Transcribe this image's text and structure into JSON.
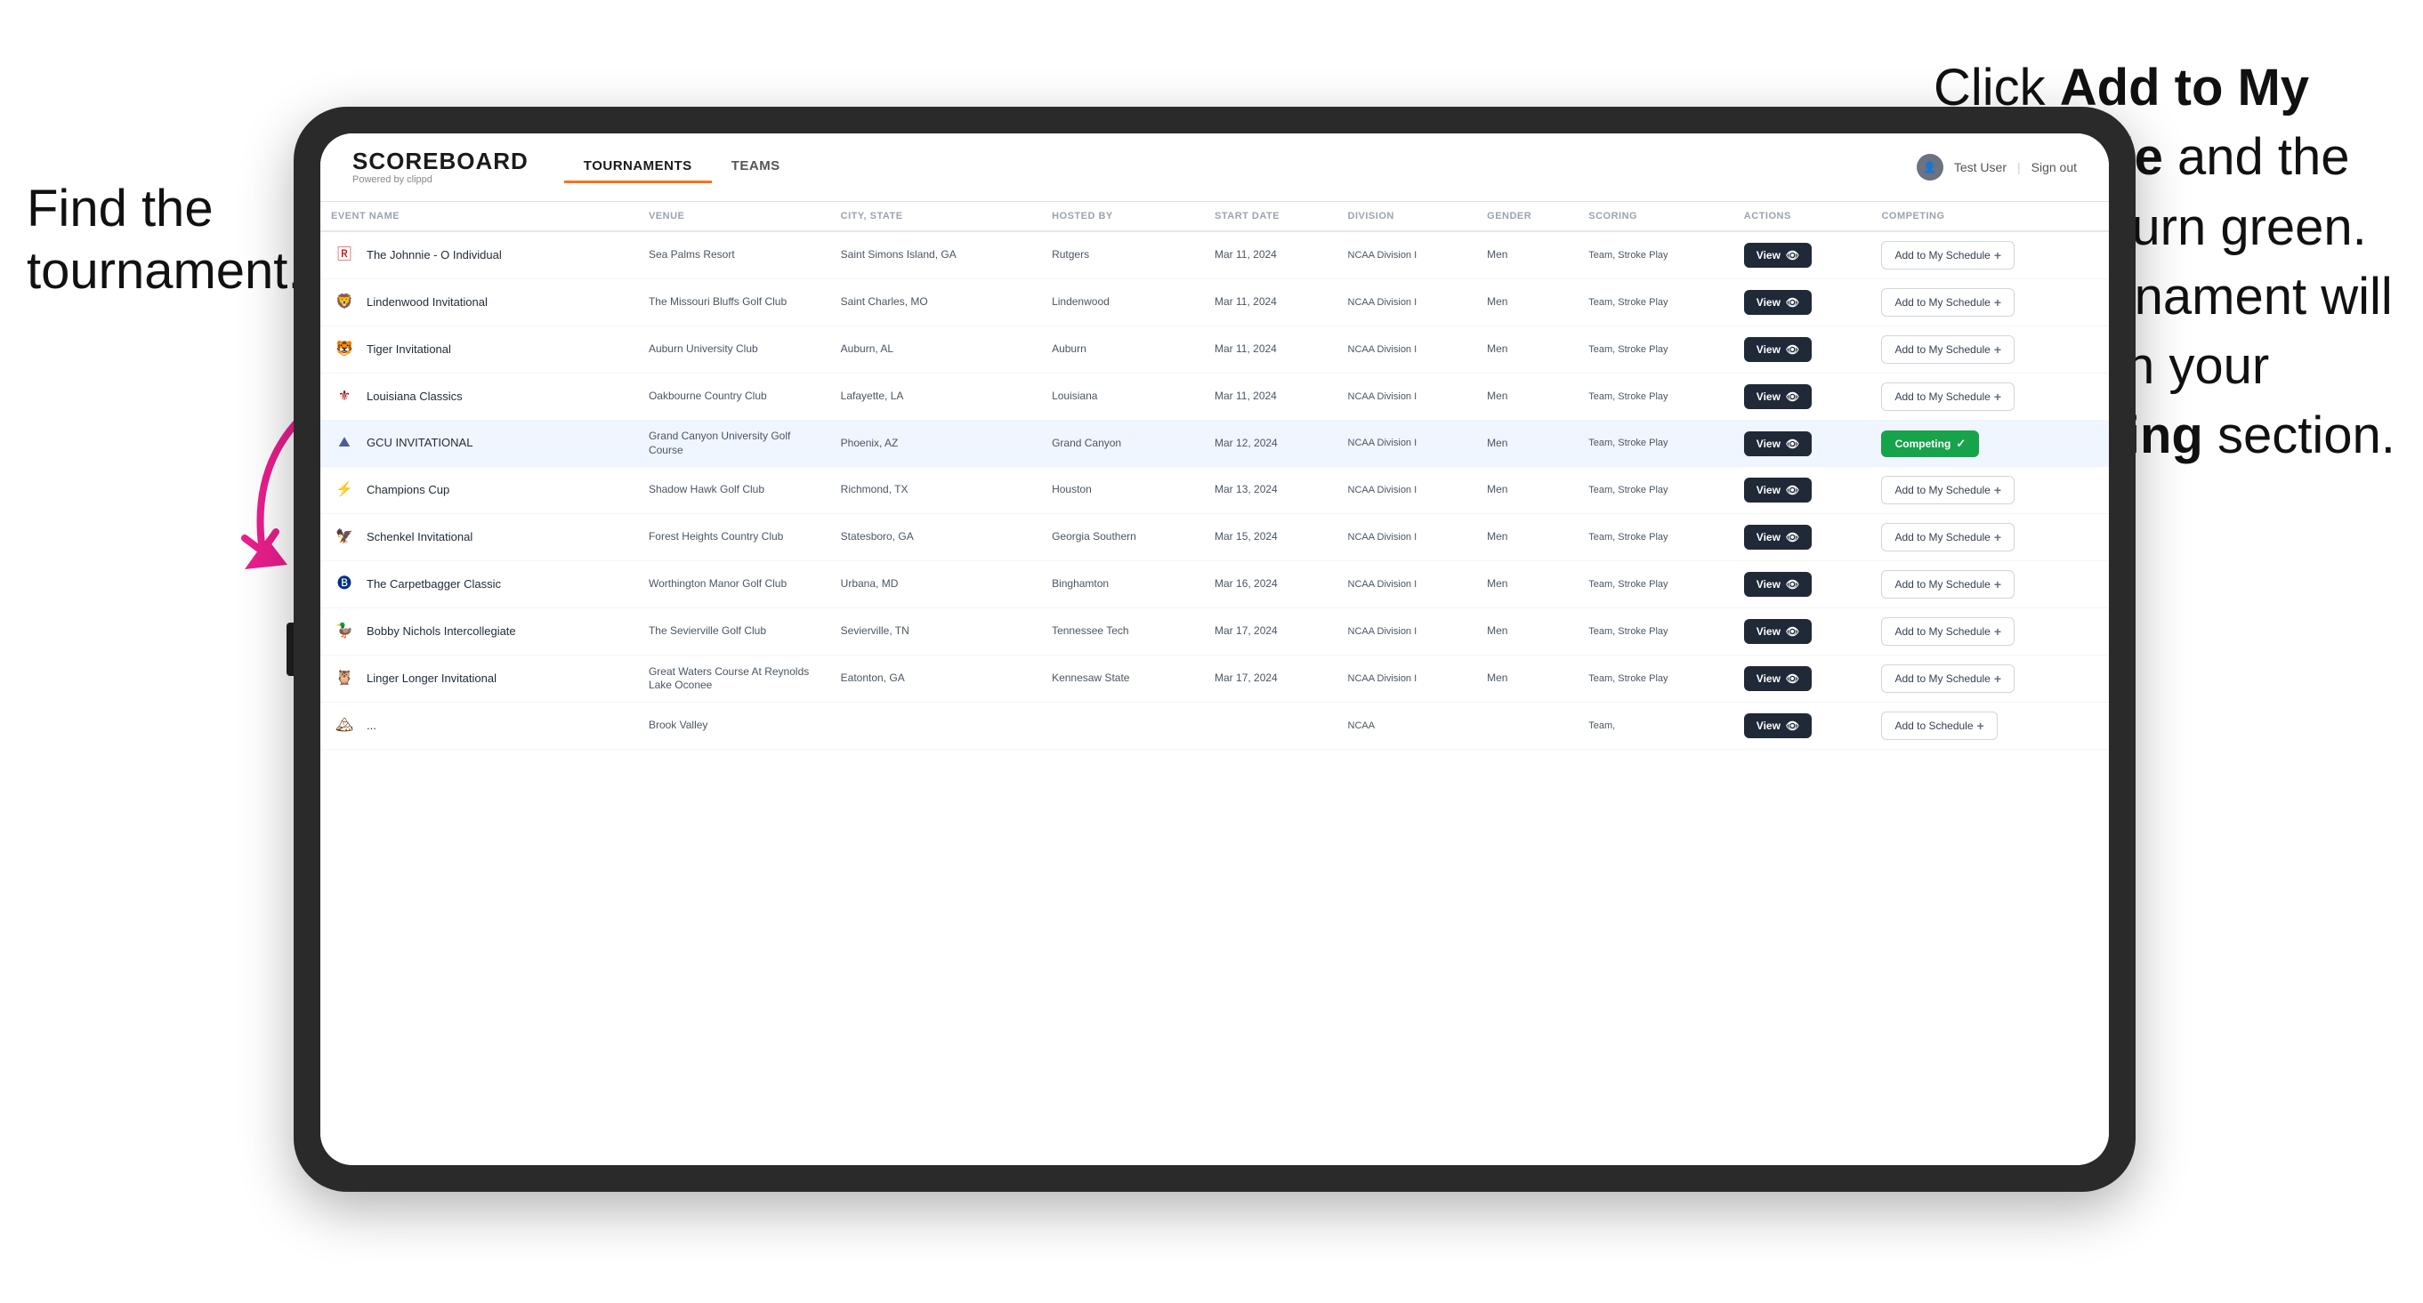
{
  "annotations": {
    "left_title": "Find the tournament.",
    "right_text_1": "Click ",
    "right_bold_1": "Add to My Schedule",
    "right_text_2": " and the box will turn green. This tournament will now be in your ",
    "right_bold_2": "Competing",
    "right_text_3": " section."
  },
  "nav": {
    "logo": "SCOREBOARD",
    "powered_by": "Powered by clippd",
    "tabs": [
      "TOURNAMENTS",
      "TEAMS"
    ],
    "active_tab": "TOURNAMENTS",
    "user_label": "Test User",
    "sign_out": "Sign out"
  },
  "table": {
    "columns": [
      "EVENT NAME",
      "VENUE",
      "CITY, STATE",
      "HOSTED BY",
      "START DATE",
      "DIVISION",
      "GENDER",
      "SCORING",
      "ACTIONS",
      "COMPETING"
    ],
    "rows": [
      {
        "logo": "🅁",
        "logo_color": "#cc0000",
        "event_name": "The Johnnie - O Individual",
        "venue": "Sea Palms Resort",
        "city_state": "Saint Simons Island, GA",
        "hosted_by": "Rutgers",
        "start_date": "Mar 11, 2024",
        "division": "NCAA Division I",
        "gender": "Men",
        "scoring": "Team, Stroke Play",
        "action": "View",
        "competing": "Add to My Schedule",
        "is_competing": false,
        "highlighted": false
      },
      {
        "logo": "🦁",
        "logo_color": "#8B0000",
        "event_name": "Lindenwood Invitational",
        "venue": "The Missouri Bluffs Golf Club",
        "city_state": "Saint Charles, MO",
        "hosted_by": "Lindenwood",
        "start_date": "Mar 11, 2024",
        "division": "NCAA Division I",
        "gender": "Men",
        "scoring": "Team, Stroke Play",
        "action": "View",
        "competing": "Add to My Schedule",
        "is_competing": false,
        "highlighted": false
      },
      {
        "logo": "🐯",
        "logo_color": "#FF6600",
        "event_name": "Tiger Invitational",
        "venue": "Auburn University Club",
        "city_state": "Auburn, AL",
        "hosted_by": "Auburn",
        "start_date": "Mar 11, 2024",
        "division": "NCAA Division I",
        "gender": "Men",
        "scoring": "Team, Stroke Play",
        "action": "View",
        "competing": "Add to My Schedule",
        "is_competing": false,
        "highlighted": false
      },
      {
        "logo": "⚜",
        "logo_color": "#990000",
        "event_name": "Louisiana Classics",
        "venue": "Oakbourne Country Club",
        "city_state": "Lafayette, LA",
        "hosted_by": "Louisiana",
        "start_date": "Mar 11, 2024",
        "division": "NCAA Division I",
        "gender": "Men",
        "scoring": "Team, Stroke Play",
        "action": "View",
        "competing": "Add to My Schedule",
        "is_competing": false,
        "highlighted": false
      },
      {
        "logo": "⛰",
        "logo_color": "#4B5E91",
        "event_name": "GCU INVITATIONAL",
        "venue": "Grand Canyon University Golf Course",
        "city_state": "Phoenix, AZ",
        "hosted_by": "Grand Canyon",
        "start_date": "Mar 12, 2024",
        "division": "NCAA Division I",
        "gender": "Men",
        "scoring": "Team, Stroke Play",
        "action": "View",
        "competing": "Competing",
        "is_competing": true,
        "highlighted": true
      },
      {
        "logo": "⚡",
        "logo_color": "#CC0000",
        "event_name": "Champions Cup",
        "venue": "Shadow Hawk Golf Club",
        "city_state": "Richmond, TX",
        "hosted_by": "Houston",
        "start_date": "Mar 13, 2024",
        "division": "NCAA Division I",
        "gender": "Men",
        "scoring": "Team, Stroke Play",
        "action": "View",
        "competing": "Add to My Schedule",
        "is_competing": false,
        "highlighted": false
      },
      {
        "logo": "🦅",
        "logo_color": "#003366",
        "event_name": "Schenkel Invitational",
        "venue": "Forest Heights Country Club",
        "city_state": "Statesboro, GA",
        "hosted_by": "Georgia Southern",
        "start_date": "Mar 15, 2024",
        "division": "NCAA Division I",
        "gender": "Men",
        "scoring": "Team, Stroke Play",
        "action": "View",
        "competing": "Add to My Schedule",
        "is_competing": false,
        "highlighted": false
      },
      {
        "logo": "🅑",
        "logo_color": "#003087",
        "event_name": "The Carpetbagger Classic",
        "venue": "Worthington Manor Golf Club",
        "city_state": "Urbana, MD",
        "hosted_by": "Binghamton",
        "start_date": "Mar 16, 2024",
        "division": "NCAA Division I",
        "gender": "Men",
        "scoring": "Team, Stroke Play",
        "action": "View",
        "competing": "Add to My Schedule",
        "is_competing": false,
        "highlighted": false
      },
      {
        "logo": "🦆",
        "logo_color": "#6B2D8B",
        "event_name": "Bobby Nichols Intercollegiate",
        "venue": "The Sevierville Golf Club",
        "city_state": "Sevierville, TN",
        "hosted_by": "Tennessee Tech",
        "start_date": "Mar 17, 2024",
        "division": "NCAA Division I",
        "gender": "Men",
        "scoring": "Team, Stroke Play",
        "action": "View",
        "competing": "Add to My Schedule",
        "is_competing": false,
        "highlighted": false
      },
      {
        "logo": "🦉",
        "logo_color": "#CC8800",
        "event_name": "Linger Longer Invitational",
        "venue": "Great Waters Course At Reynolds Lake Oconee",
        "city_state": "Eatonton, GA",
        "hosted_by": "Kennesaw State",
        "start_date": "Mar 17, 2024",
        "division": "NCAA Division I",
        "gender": "Men",
        "scoring": "Team, Stroke Play",
        "action": "View",
        "competing": "Add to My Schedule",
        "is_competing": false,
        "highlighted": false
      },
      {
        "logo": "🏔",
        "logo_color": "#663300",
        "event_name": "...",
        "venue": "Brook Valley",
        "city_state": "",
        "hosted_by": "",
        "start_date": "",
        "division": "NCAA",
        "gender": "",
        "scoring": "Team,",
        "action": "View",
        "competing": "Add to Schedule",
        "is_competing": false,
        "highlighted": false
      }
    ]
  }
}
